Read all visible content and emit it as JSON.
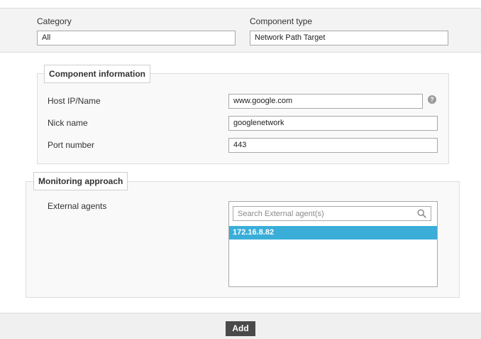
{
  "header": {
    "category": {
      "label": "Category",
      "value": "All"
    },
    "component_type": {
      "label": "Component type",
      "value": "Network Path Target"
    }
  },
  "component_information": {
    "legend": "Component information",
    "host": {
      "label": "Host IP/Name",
      "value": "www.google.com",
      "help_icon": "question-circle-icon"
    },
    "nick_name": {
      "label": "Nick name",
      "value": "googlenetwork"
    },
    "port_number": {
      "label": "Port number",
      "value": "443"
    }
  },
  "monitoring_approach": {
    "legend": "Monitoring approach",
    "external_agents": {
      "label": "External agents",
      "search_placeholder": "Search External agent(s)",
      "search_icon": "search-icon",
      "items": [
        "172.16.8.82"
      ],
      "selected_color": "#3aaed8"
    }
  },
  "footer": {
    "add_label": "Add"
  }
}
